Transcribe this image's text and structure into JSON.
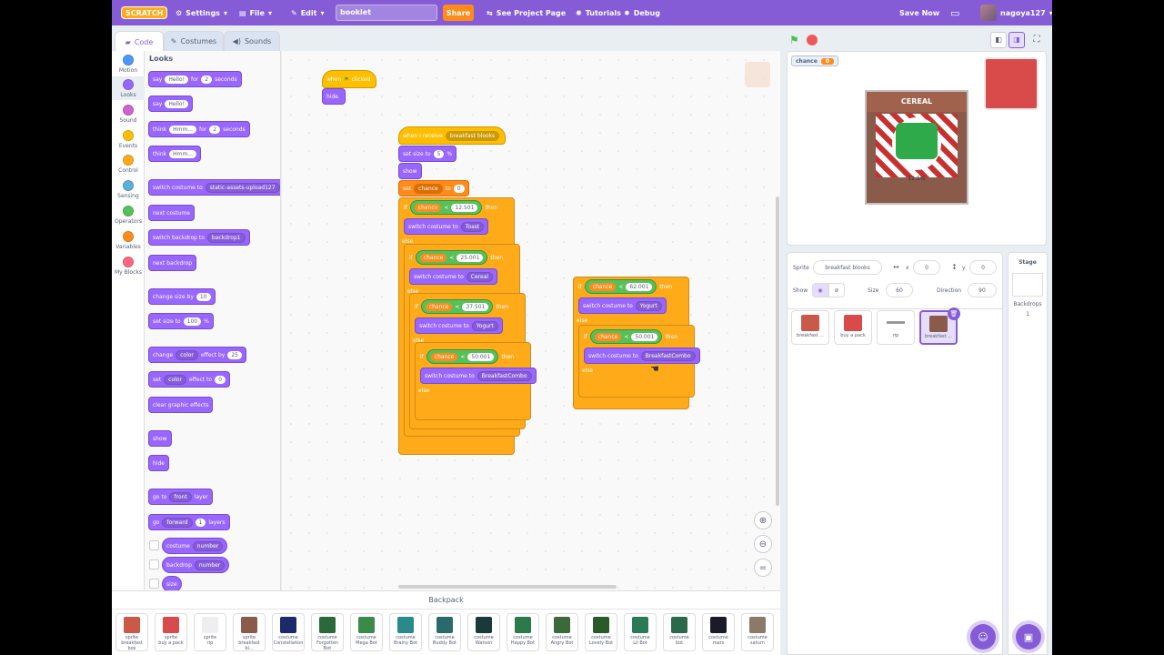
{
  "menubar": {
    "logo": "SCRATCH",
    "settings": "Settings",
    "file": "File",
    "edit": "Edit",
    "project_title": "booklet",
    "share": "Share",
    "see_project": "See Project Page",
    "tutorials": "Tutorials",
    "debug": "Debug",
    "save_now": "Save Now",
    "username": "nagoya127"
  },
  "tabs": {
    "code": "Code",
    "costumes": "Costumes",
    "sounds": "Sounds"
  },
  "categories": [
    {
      "label": "Motion",
      "color": "#4c97ff"
    },
    {
      "label": "Looks",
      "color": "#9966ff"
    },
    {
      "label": "Sound",
      "color": "#cf63cf"
    },
    {
      "label": "Events",
      "color": "#ffbf00"
    },
    {
      "label": "Control",
      "color": "#ffab19"
    },
    {
      "label": "Sensing",
      "color": "#5cb1d6"
    },
    {
      "label": "Operators",
      "color": "#59c059"
    },
    {
      "label": "Variables",
      "color": "#ff8c1a"
    },
    {
      "label": "My Blocks",
      "color": "#ff6680"
    }
  ],
  "palette": {
    "heading": "Looks",
    "say_for": {
      "a": "say",
      "b": "Hello!",
      "c": "for",
      "d": "2",
      "e": "seconds"
    },
    "say": {
      "a": "say",
      "b": "Hello!"
    },
    "think_for": {
      "a": "think",
      "b": "Hmm...",
      "c": "for",
      "d": "2",
      "e": "seconds"
    },
    "think": {
      "a": "think",
      "b": "Hmm..."
    },
    "switch_costume": {
      "a": "switch costume to",
      "b": "static-assets-upload127"
    },
    "next_costume": "next costume",
    "switch_backdrop": {
      "a": "switch backdrop to",
      "b": "backdrop1"
    },
    "next_backdrop": "next backdrop",
    "change_size": {
      "a": "change size by",
      "b": "10"
    },
    "set_size": {
      "a": "set size to",
      "b": "100",
      "c": "%"
    },
    "change_effect": {
      "a": "change",
      "b": "color",
      "c": "effect by",
      "d": "25"
    },
    "set_effect": {
      "a": "set",
      "b": "color",
      "c": "effect to",
      "d": "0"
    },
    "clear_effects": "clear graphic effects",
    "show": "show",
    "hide": "hide",
    "go_to": {
      "a": "go to",
      "b": "front",
      "c": "layer"
    },
    "go_layers": {
      "a": "go",
      "b": "forward",
      "c": "1",
      "d": "layers"
    },
    "costume_number": {
      "a": "costume",
      "b": "number"
    },
    "backdrop_number": {
      "a": "backdrop",
      "b": "number"
    },
    "size": "size"
  },
  "script1": {
    "when": "when",
    "clicked": "clicked",
    "hide": "hide"
  },
  "script2": {
    "when_receive": "when I receive",
    "message": "breakfast blooks",
    "set_size": "set size to",
    "size_val": "5",
    "pct": "%",
    "show": "show",
    "set": "set",
    "var": "chance",
    "to": "to",
    "set_val": "0",
    "if": "if",
    "then": "then",
    "else": "else",
    "lt": "<",
    "c1": "12.501",
    "c2": "25.001",
    "c3": "37.501",
    "c4": "50.001",
    "switch_costume": "switch costume to",
    "costume1": "Toast",
    "costume2": "Cereal",
    "costume3": "Yogurt",
    "costume4": "BreakfastCombo"
  },
  "script3": {
    "if": "if",
    "then": "then",
    "else": "else",
    "var": "chance",
    "lt": "<",
    "c1": "62.001",
    "c2": "50.001",
    "switch_costume": "switch costume to",
    "costume1": "Yogurt",
    "costume2": "BreakfastCombo"
  },
  "stage": {
    "monitor_label": "chance",
    "monitor_value": "0",
    "card_title": "CEREAL",
    "card_percent": "12.5%"
  },
  "sprite_info": {
    "sprite_label": "Sprite",
    "sprite_name": "breakfast blooks",
    "x_label": "x",
    "x": "0",
    "y_label": "y",
    "y": "0",
    "show_label": "Show",
    "size_label": "Size",
    "size": "60",
    "direction_label": "Direction",
    "direction": "90"
  },
  "sprites": [
    {
      "name": "breakfast ..."
    },
    {
      "name": "buy a pack"
    },
    {
      "name": "rip"
    },
    {
      "name": "breakfast ..."
    }
  ],
  "stage_pane": {
    "title": "Stage",
    "backdrops_label": "Backdrops",
    "backdrops_count": "1"
  },
  "backpack": {
    "title": "Backpack",
    "items": [
      {
        "type": "sprite",
        "name": "breakfast box"
      },
      {
        "type": "sprite",
        "name": "buy a pack"
      },
      {
        "type": "sprite",
        "name": "rip"
      },
      {
        "type": "sprite",
        "name": "breakfast bl..."
      },
      {
        "type": "costume",
        "name": "Constellation"
      },
      {
        "type": "costume",
        "name": "Forgotten Bot"
      },
      {
        "type": "costume",
        "name": "Mega Bot"
      },
      {
        "type": "costume",
        "name": "Brainy Bot"
      },
      {
        "type": "costume",
        "name": "Buddy Bot"
      },
      {
        "type": "costume",
        "name": "Watson"
      },
      {
        "type": "costume",
        "name": "Happy Bot"
      },
      {
        "type": "costume",
        "name": "Angry Bot"
      },
      {
        "type": "costume",
        "name": "Lovely Bot"
      },
      {
        "type": "costume",
        "name": "Lil Bot"
      },
      {
        "type": "costume",
        "name": "bot"
      },
      {
        "type": "costume",
        "name": "mars"
      },
      {
        "type": "costume",
        "name": "saturn"
      }
    ]
  }
}
